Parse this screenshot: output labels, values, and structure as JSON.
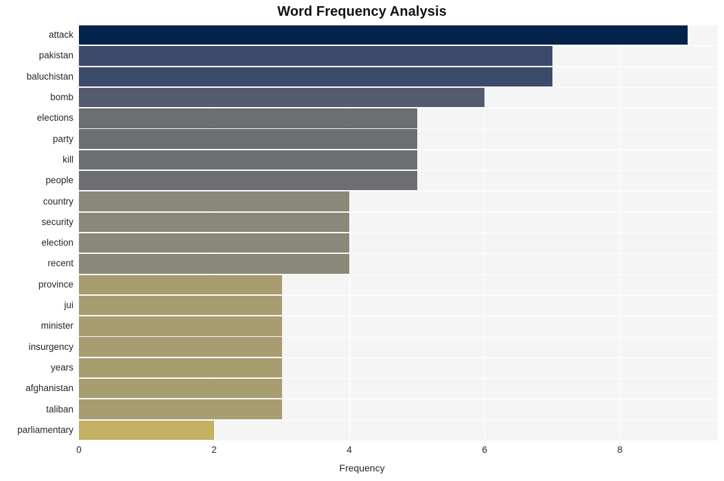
{
  "chart_data": {
    "type": "bar",
    "orientation": "horizontal",
    "title": "Word Frequency Analysis",
    "xlabel": "Frequency",
    "ylabel": "",
    "xlim": [
      0,
      9.45
    ],
    "xticks": [
      0,
      2,
      4,
      6,
      8
    ],
    "xticklabels": [
      "0",
      "2",
      "4",
      "6",
      "8"
    ],
    "grid": true,
    "legend": null,
    "background": "#f5f5f6",
    "categories": [
      "attack",
      "pakistan",
      "baluchistan",
      "bomb",
      "elections",
      "party",
      "kill",
      "people",
      "country",
      "security",
      "election",
      "recent",
      "province",
      "jui",
      "minister",
      "insurgency",
      "years",
      "afghanistan",
      "taliban",
      "parliamentary"
    ],
    "values": [
      9,
      7,
      7,
      6,
      5,
      5,
      5,
      5,
      4,
      4,
      4,
      4,
      3,
      3,
      3,
      3,
      3,
      3,
      3,
      2
    ],
    "colors": [
      "#03234a",
      "#3c4a6b",
      "#3c4a6b",
      "#565c70",
      "#6d6e71",
      "#6d6e71",
      "#6d6e71",
      "#6d6e71",
      "#8a8878",
      "#8a8878",
      "#8a8878",
      "#8a8878",
      "#a79d71",
      "#a79d71",
      "#a79d71",
      "#a79d71",
      "#a79d71",
      "#a79d71",
      "#a79d71",
      "#c3b264"
    ]
  }
}
